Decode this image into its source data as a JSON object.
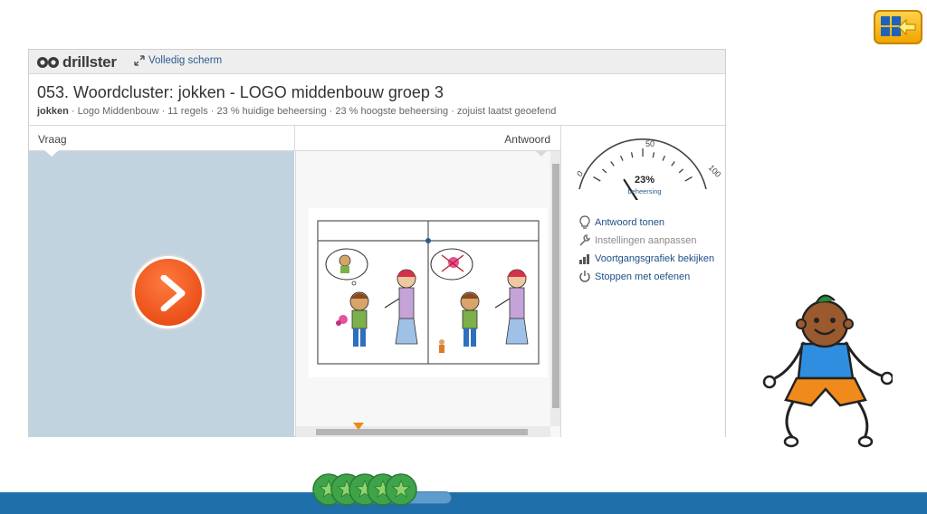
{
  "app": {
    "logo_text": "drillster",
    "fullscreen_label": "Volledig scherm",
    "back_button_icon": "grid-back-arrow-icon"
  },
  "course": {
    "title": "053. Woordcluster: jokken - LOGO middenbouw groep 3",
    "meta_bold": "jokken",
    "meta_rest": " · Logo Middenbouw · 11 regels · 23 % huidige beheersing · 23 % hoogste beheersing · zojuist laatst geoefend"
  },
  "panels": {
    "question_label": "Vraag",
    "answer_label": "Antwoord"
  },
  "gauge": {
    "value_text": "23%",
    "value": 23,
    "caption": "beheersing",
    "min_label": "0",
    "mid_label": "50",
    "max_label": "100"
  },
  "actions": [
    {
      "label": "Antwoord tonen",
      "icon": "lightbulb-icon",
      "enabled": true
    },
    {
      "label": "Instellingen aanpassen",
      "icon": "wrench-icon",
      "enabled": false
    },
    {
      "label": "Voortgangsgrafiek bekijken",
      "icon": "bar-chart-icon",
      "enabled": true
    },
    {
      "label": "Stoppen met oefenen",
      "icon": "power-icon",
      "enabled": true
    }
  ],
  "progress": {
    "stars_earned": 5
  },
  "colors": {
    "question_bg": "#c2d3e0",
    "play_button": "#e2400b",
    "link": "#1d4f86",
    "bottom_bar": "#1f6fab"
  }
}
